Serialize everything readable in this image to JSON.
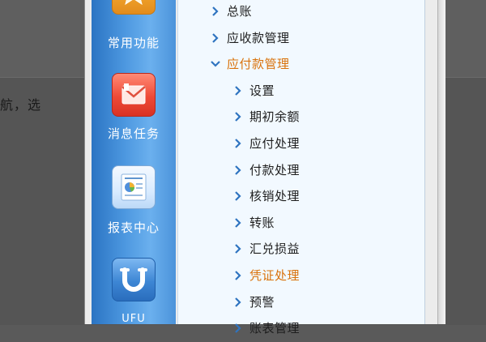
{
  "background": {
    "text": "航，选"
  },
  "sidebar": {
    "items": [
      {
        "label": "常用功能",
        "icon": "star-icon"
      },
      {
        "label": "消息任务",
        "icon": "envelope-icon"
      },
      {
        "label": "报表中心",
        "icon": "report-icon"
      },
      {
        "label": "UFU",
        "icon": "u-logo-icon"
      }
    ]
  },
  "tree": {
    "items": [
      {
        "label": "总账",
        "level": 0,
        "state": "collapsed"
      },
      {
        "label": "应收款管理",
        "level": 0,
        "state": "collapsed"
      },
      {
        "label": "应付款管理",
        "level": 0,
        "state": "expanded"
      },
      {
        "label": "设置",
        "level": 1,
        "state": "collapsed"
      },
      {
        "label": "期初余额",
        "level": 1,
        "state": "collapsed"
      },
      {
        "label": "应付处理",
        "level": 1,
        "state": "collapsed"
      },
      {
        "label": "付款处理",
        "level": 1,
        "state": "collapsed"
      },
      {
        "label": "核销处理",
        "level": 1,
        "state": "collapsed"
      },
      {
        "label": "转账",
        "level": 1,
        "state": "collapsed"
      },
      {
        "label": "汇兑损益",
        "level": 1,
        "state": "collapsed"
      },
      {
        "label": "凭证处理",
        "level": 1,
        "state": "hovered"
      },
      {
        "label": "预警",
        "level": 1,
        "state": "collapsed"
      },
      {
        "label": "账表管理",
        "level": 1,
        "state": "collapsed"
      }
    ]
  },
  "colors": {
    "sidebar": "#4d98e0",
    "content_bg": "#f2f9ff",
    "highlight_text": "#d9720b",
    "arrow": "#2f74c0"
  }
}
